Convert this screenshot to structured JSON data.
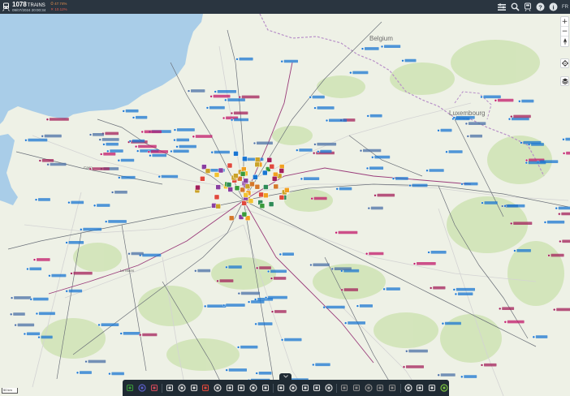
{
  "header": {
    "train_count": "1078",
    "train_label": "TRAINS",
    "datetime": "09/07/2024 20:00:34",
    "pct_up": "47.74%",
    "pct_down": "10.12%",
    "language": "FR"
  },
  "map": {
    "countries": [
      "Belgium",
      "Luxembourg"
    ],
    "places": [
      "Caen",
      "Le Mans"
    ],
    "scale_label": "50 km"
  },
  "toolbar": {
    "buttons": [
      "train-icon",
      "cursor-icon",
      "rail-icon",
      "station-icon",
      "calendar-icon",
      "phone-icon",
      "pause-icon",
      "flag-icon",
      "tgv-icon",
      "ter-icon",
      "intercites-icon",
      "grid-icon",
      "layers-icon",
      "building-icon",
      "fork-icon",
      "person-icon",
      "crane-icon",
      "dot-icon",
      "line-icon",
      "wave-icon",
      "zigzag-icon",
      "sun-icon",
      "route-icon",
      "link-icon",
      "pin-icon",
      "location-icon"
    ]
  },
  "colors": {
    "header_bg": "#2a3540",
    "ter": "#1976d2",
    "inoui": "#a31f5a",
    "ouigo": "#c2186a",
    "intercites": "#4a6fa5",
    "transilien": "#f0a020",
    "rer_green": "#3a9a3a"
  }
}
